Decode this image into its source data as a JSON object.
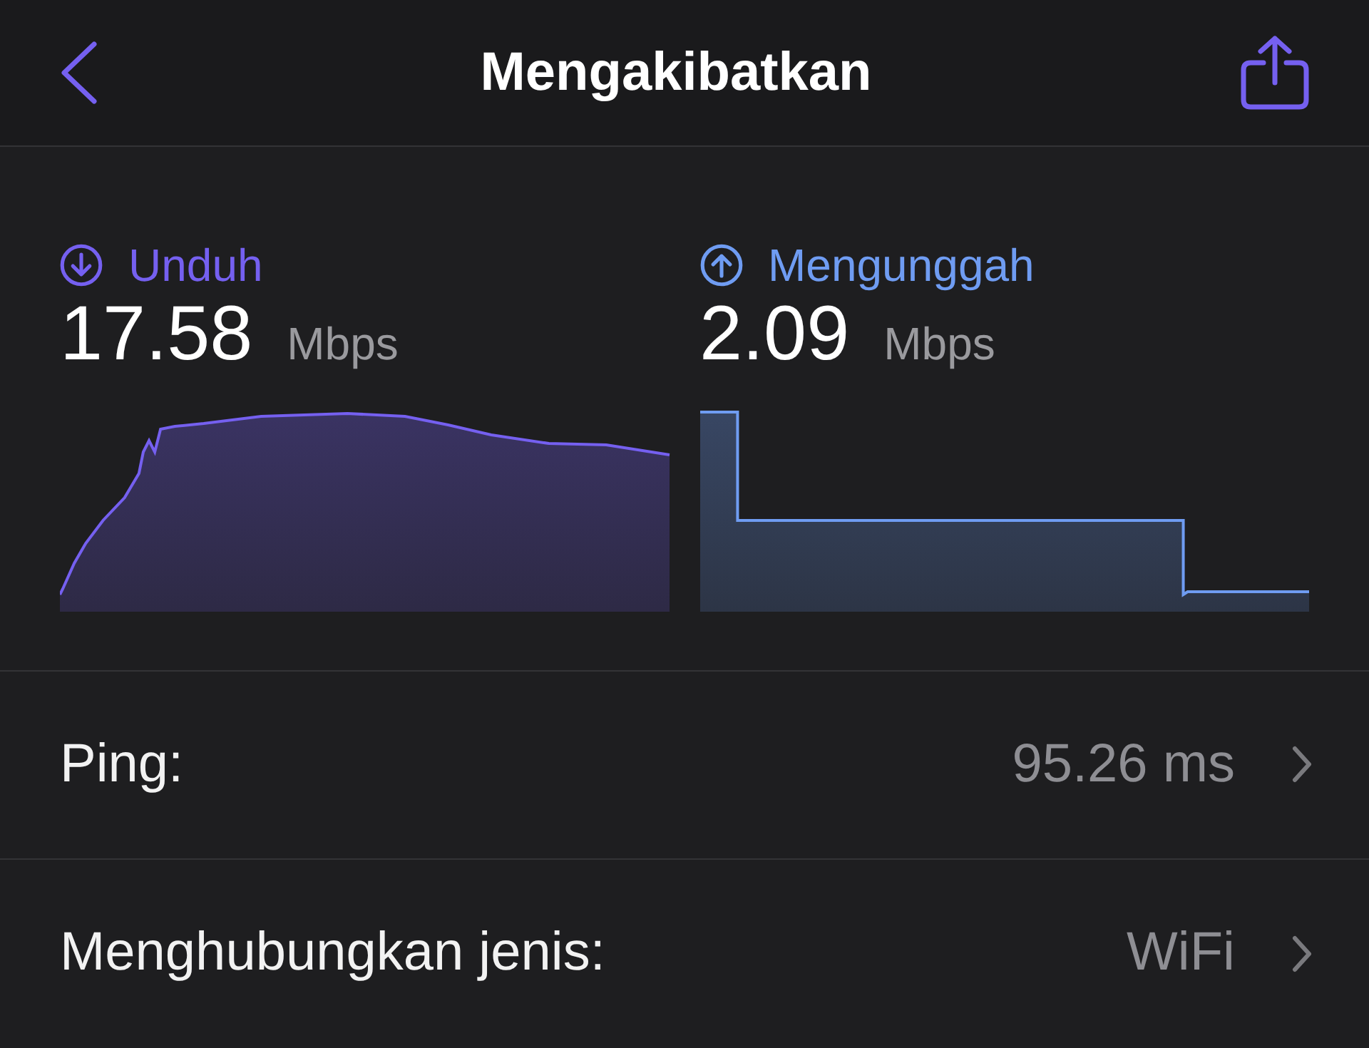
{
  "header": {
    "title": "Mengakibatkan"
  },
  "results": [
    {
      "kind": "download",
      "label": "Unduh",
      "value": "17.58",
      "unit": "Mbps",
      "color": "#7560f0"
    },
    {
      "kind": "upload",
      "label": "Mengunggah",
      "value": "2.09",
      "unit": "Mbps",
      "color": "#6f9cf2"
    }
  ],
  "rows": [
    {
      "label": "Ping:",
      "value": "95.26 ms"
    },
    {
      "label": "Menghubungkan jenis:",
      "value": "WiFi"
    }
  ]
}
